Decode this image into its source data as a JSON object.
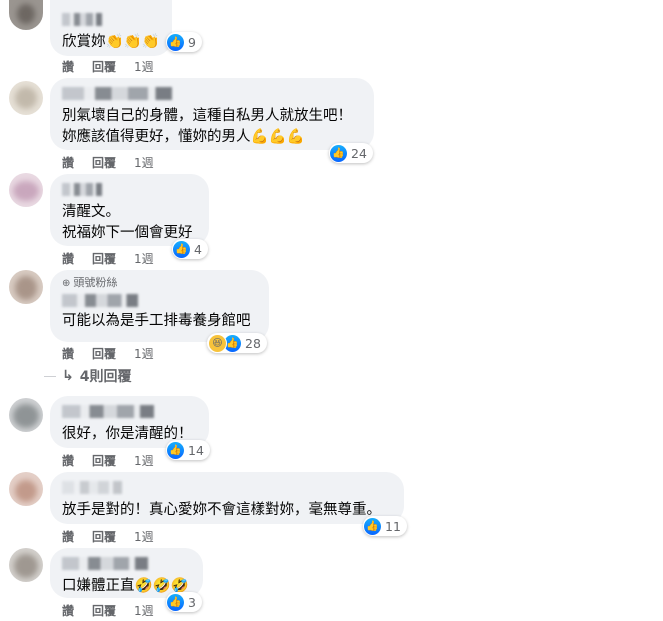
{
  "comments": [
    {
      "text": "欣賞妳👏👏👏",
      "reactions": "9",
      "actions": {
        "like": "讚",
        "reply": "回覆",
        "time": "1週"
      }
    },
    {
      "text": "別氣壞自己的身體，這種自私男人就放生吧！\n妳應該值得更好，懂妳的男人💪💪💪",
      "reactions": "24",
      "actions": {
        "like": "讚",
        "reply": "回覆",
        "time": "1週"
      }
    },
    {
      "text": "清醒文。\n祝福妳下一個會更好",
      "reactions": "4",
      "actions": {
        "like": "讚",
        "reply": "回覆",
        "time": "1週"
      }
    },
    {
      "badge": "頭號粉絲",
      "text": "可能以為是手工排毒養身館吧",
      "reactions": "28",
      "actions": {
        "like": "讚",
        "reply": "回覆",
        "time": "1週"
      }
    },
    {
      "text": "很好，你是清醒的！",
      "reactions": "14",
      "actions": {
        "like": "讚",
        "reply": "回覆",
        "time": "1週"
      }
    },
    {
      "text": "放手是對的！真心愛妳不會這樣對妳，毫無尊重。",
      "reactions": "11",
      "actions": {
        "like": "讚",
        "reply": "回覆",
        "time": "1週"
      }
    },
    {
      "text": "口嫌體正直🤣🤣🤣",
      "reactions": "3",
      "actions": {
        "like": "讚",
        "reply": "回覆",
        "time": "1週"
      }
    }
  ],
  "view_replies": "4則回覆",
  "colors": {
    "like_blue": "#0866ff",
    "bubble_bg": "#f0f2f5",
    "meta_gray": "#65676b"
  }
}
